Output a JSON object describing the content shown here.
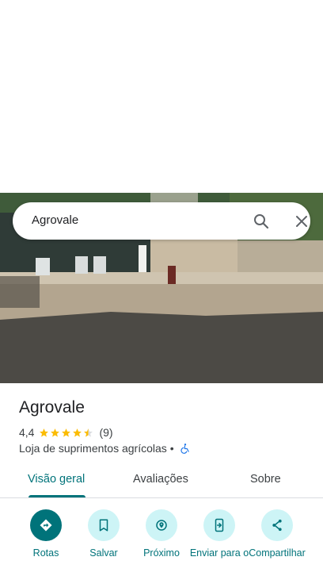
{
  "search": {
    "query": "Agrovale"
  },
  "place": {
    "title": "Agrovale",
    "rating": "4,4",
    "reviews": "(9)",
    "category": "Loja de suprimentos agrícolas",
    "separator": "•"
  },
  "tabs": [
    {
      "label": "Visão geral",
      "active": true
    },
    {
      "label": "Avaliações",
      "active": false
    },
    {
      "label": "Sobre",
      "active": false
    }
  ],
  "actions": [
    {
      "label": "Rotas",
      "icon": "directions-icon"
    },
    {
      "label": "Salvar",
      "icon": "bookmark-icon"
    },
    {
      "label": "Próximo",
      "icon": "nearby-icon"
    },
    {
      "label": "Enviar para o",
      "icon": "send-to-phone-icon"
    },
    {
      "label": "Compartilhar",
      "icon": "share-icon"
    }
  ],
  "colors": {
    "accent": "#00737a",
    "accent_light": "#cdf4f6",
    "star": "#fbbc04"
  }
}
